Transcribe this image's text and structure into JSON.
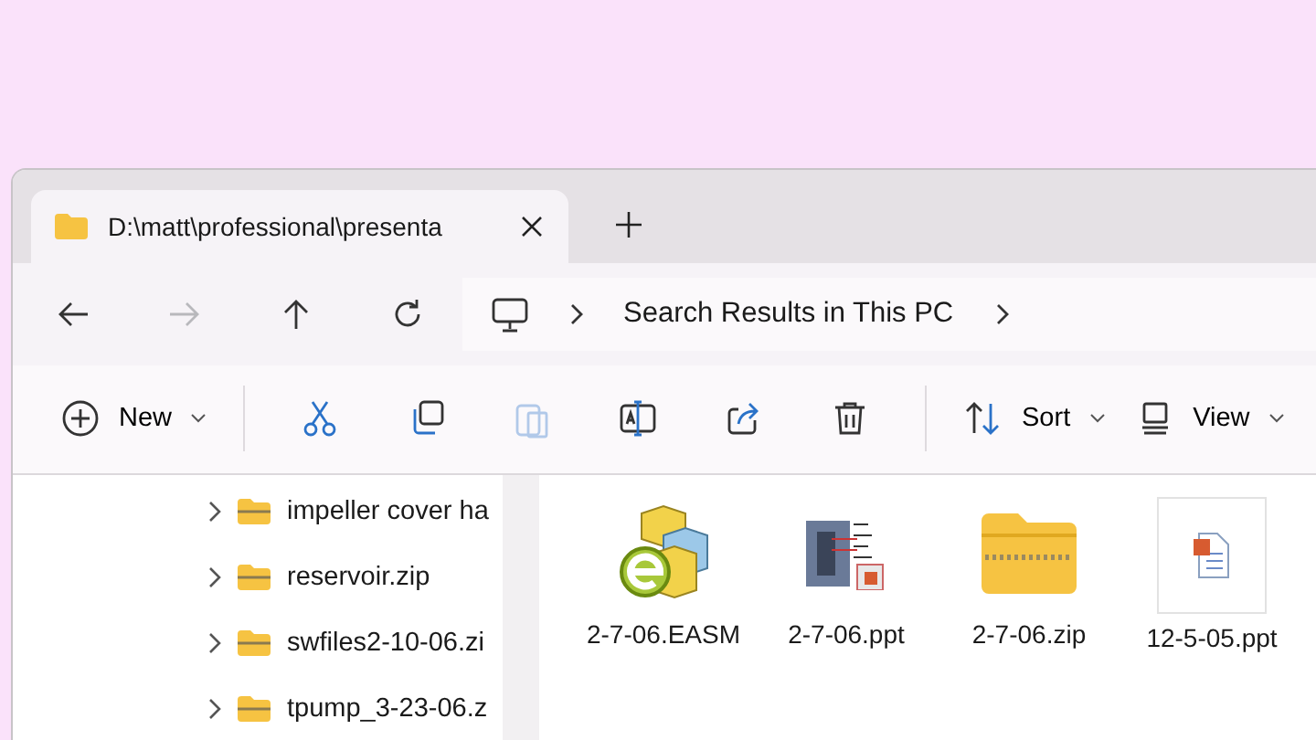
{
  "tabs": [
    {
      "title": "D:\\matt\\professional\\presenta",
      "selected": true
    }
  ],
  "nav": [
    {
      "kind": "back",
      "disabled": false
    },
    {
      "kind": "forward",
      "disabled": true
    },
    {
      "kind": "up",
      "disabled": false
    },
    {
      "kind": "refresh",
      "disabled": false
    }
  ],
  "address": {
    "crumbs": [
      "Search Results in This PC"
    ]
  },
  "commands": [
    {
      "kind": "new",
      "label": "New",
      "disabled": false
    },
    {
      "kind": "cut",
      "disabled": false
    },
    {
      "kind": "copy",
      "disabled": false
    },
    {
      "kind": "paste",
      "disabled": true
    },
    {
      "kind": "rename",
      "disabled": false
    },
    {
      "kind": "share",
      "disabled": false
    },
    {
      "kind": "delete",
      "disabled": false
    },
    {
      "kind": "sort",
      "label": "Sort",
      "disabled": false
    },
    {
      "kind": "view",
      "label": "View",
      "disabled": false
    }
  ],
  "sidebar": {
    "items": [
      "impeller cover ha",
      "reservoir.zip",
      "swfiles2-10-06.zi",
      "tpump_3-23-06.z"
    ]
  },
  "files": [
    {
      "kind": "easm",
      "name": "2-7-06.EASM"
    },
    {
      "kind": "ppt",
      "name": "2-7-06.ppt"
    },
    {
      "kind": "zip",
      "name": "2-7-06.zip"
    },
    {
      "kind": "ppt-doc",
      "name": "12-5-05.ppt"
    }
  ]
}
